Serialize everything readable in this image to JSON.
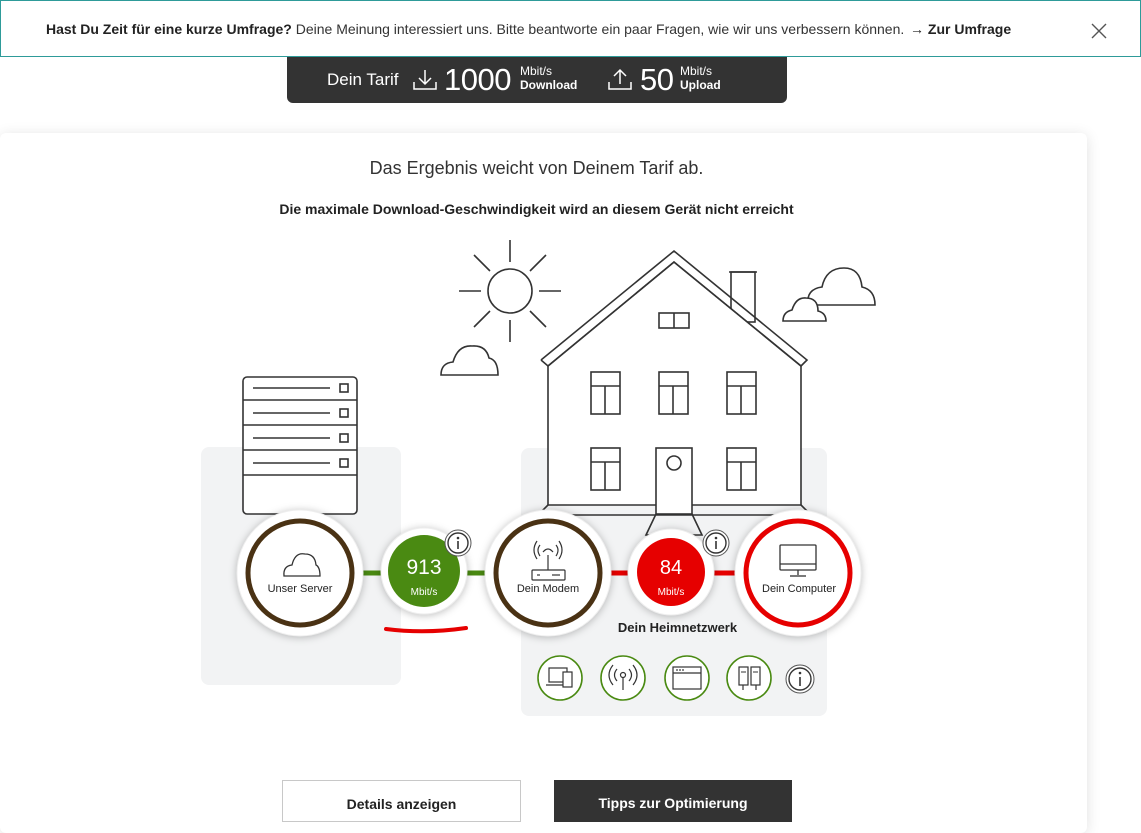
{
  "survey": {
    "question": "Hast Du Zeit für eine kurze Umfrage?",
    "text": "Deine Meinung interessiert uns. Bitte beantworte ein paar Fragen, wie wir uns verbessern können.",
    "link": "→ Zur Umfrage",
    "close_icon": "close-icon"
  },
  "tarif": {
    "label": "Dein Tarif",
    "download_value": "1000",
    "download_unit": "Mbit/s",
    "download_label": "Download",
    "upload_value": "50",
    "upload_unit": "Mbit/s",
    "upload_label": "Upload"
  },
  "result": {
    "headline": "Das Ergebnis weicht von Deinem Tarif ab.",
    "subline": "Die maximale Download-Geschwindigkeit wird an diesem Gerät nicht erreicht"
  },
  "nodes": {
    "server": "Unser Server",
    "modem": "Dein Modem",
    "computer": "Dein Computer"
  },
  "speeds": {
    "server_modem": {
      "value": "913",
      "unit": "Mbit/s",
      "color": "#4a8a12"
    },
    "modem_computer": {
      "value": "84",
      "unit": "Mbit/s",
      "color": "#e60000"
    }
  },
  "heimnetz": {
    "label": "Dein Heimnetzwerk",
    "devices": [
      "laptop-phone-icon",
      "wifi-antenna-icon",
      "browser-window-icon",
      "powerline-icon"
    ]
  },
  "buttons": {
    "details": "Details anzeigen",
    "tipps": "Tipps zur Optimierung"
  },
  "colors": {
    "good": "#4a8a12",
    "bad": "#e60000",
    "node_ring": "#4a3214",
    "accent_border": "#2e9b99"
  }
}
